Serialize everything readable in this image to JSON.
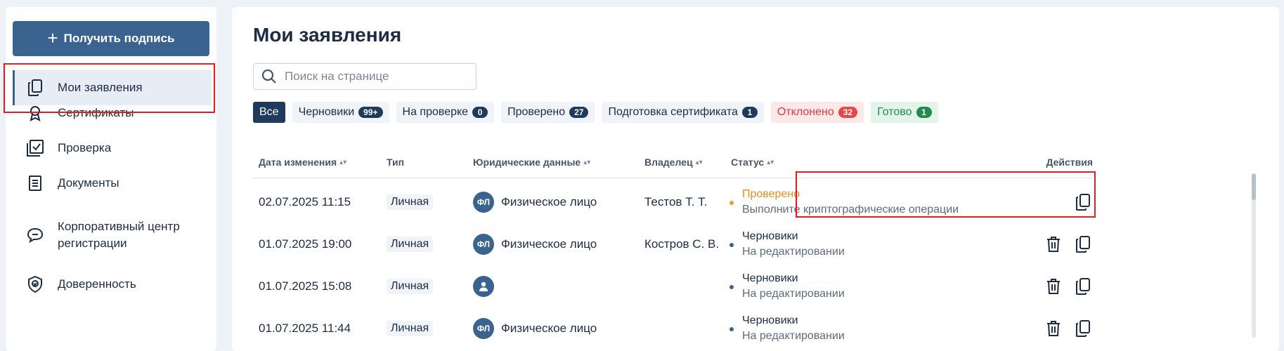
{
  "sidebar": {
    "get_sign_label": "Получить подпись",
    "items": [
      {
        "label": "Мои заявления",
        "icon": "copy-icon",
        "active": true
      },
      {
        "label": "Сертификаты",
        "icon": "award-icon"
      },
      {
        "label": "Проверка",
        "icon": "check-square-icon"
      },
      {
        "label": "Документы",
        "icon": "document-icon"
      },
      {
        "label": "Корпоративный центр регистрации",
        "icon": "chat-bubble-icon"
      },
      {
        "label": "Доверенность",
        "icon": "shield-icon"
      }
    ]
  },
  "main": {
    "title": "Мои заявления",
    "search": {
      "placeholder": "Поиск на странице",
      "value": ""
    },
    "filters": [
      {
        "label": "Все",
        "count": ""
      },
      {
        "label": "Черновики",
        "count": "99+"
      },
      {
        "label": "На проверке",
        "count": "0"
      },
      {
        "label": "Проверено",
        "count": "27"
      },
      {
        "label": "Подготовка сертификата",
        "count": "1"
      },
      {
        "label": "Отклонено",
        "count": "32"
      },
      {
        "label": "Готово",
        "count": "1"
      }
    ],
    "table": {
      "headers": {
        "date": "Дата изменения",
        "type": "Тип",
        "legal": "Юридические данные",
        "owner": "Владелец",
        "status": "Статус",
        "actions": "Действия"
      },
      "rows": [
        {
          "date": "02.07.2025 11:15",
          "type": "Личная",
          "badge": "ФЛ",
          "legal": "Физическое лицо",
          "owner": "Тестов Т. Т.",
          "status": "Проверено",
          "substatus": "Выполните криптографические операции"
        },
        {
          "date": "01.07.2025 19:00",
          "type": "Личная",
          "badge": "ФЛ",
          "legal": "Физическое лицо",
          "owner": "Костров С. В.",
          "status": "Черновики",
          "substatus": "На редактировании"
        },
        {
          "date": "01.07.2025 15:08",
          "type": "Личная",
          "badge": "",
          "legal": "",
          "owner": "",
          "status": "Черновики",
          "substatus": "На редактировании"
        },
        {
          "date": "01.07.2025 11:44",
          "type": "Личная",
          "badge": "ФЛ",
          "legal": "Физическое лицо",
          "owner": "",
          "status": "Черновики",
          "substatus": "На редактировании"
        }
      ]
    }
  },
  "colors": {
    "accent": "#3a6390",
    "dark": "#1e3a5c",
    "highlight": "#e02020",
    "orange": "#f08a1c"
  }
}
